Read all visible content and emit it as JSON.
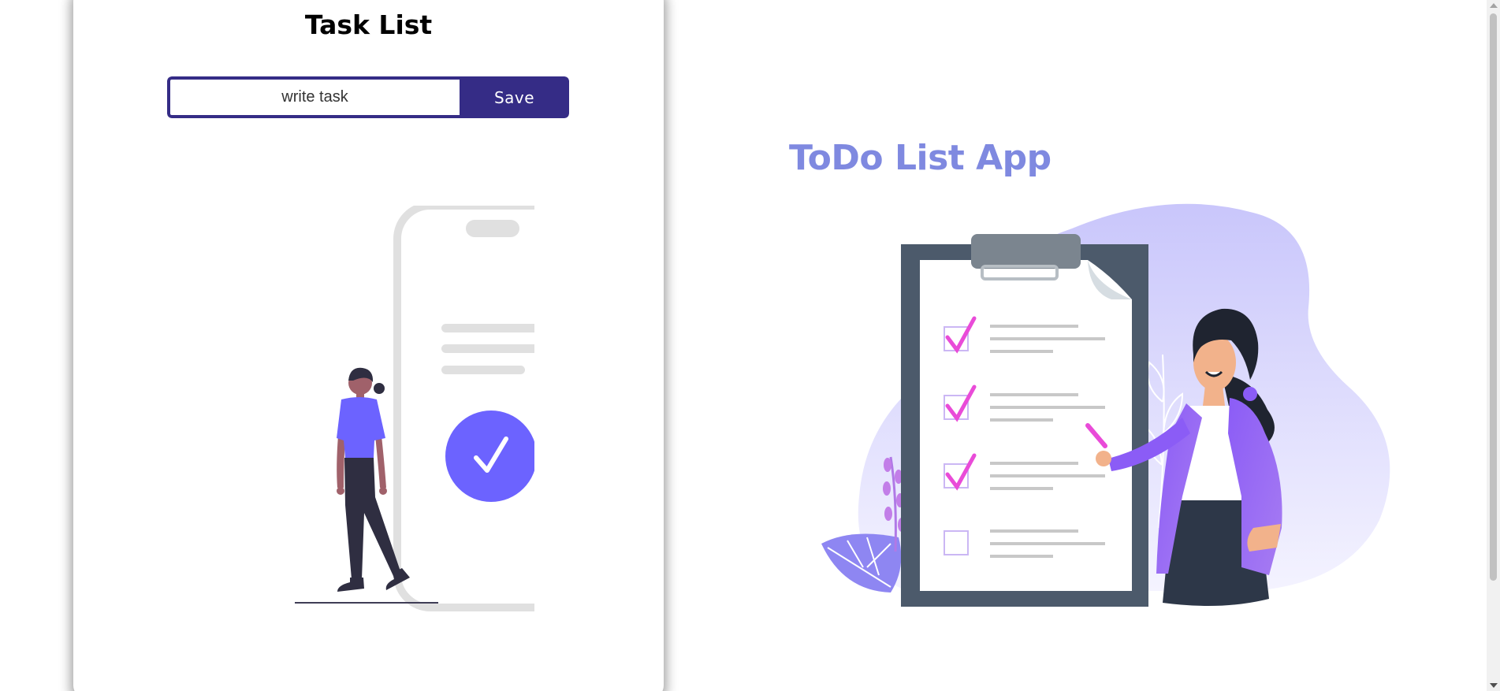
{
  "card": {
    "title": "Task List",
    "input": {
      "placeholder": "write task",
      "value": ""
    },
    "save_label": "Save"
  },
  "hero": {
    "title": "ToDo List App"
  },
  "colors": {
    "primary": "#352c86",
    "accent": "#6c63ff",
    "hero_title": "#7f89e0",
    "check": "#e94bd8"
  },
  "icons": {
    "phone_check": "check-icon"
  }
}
